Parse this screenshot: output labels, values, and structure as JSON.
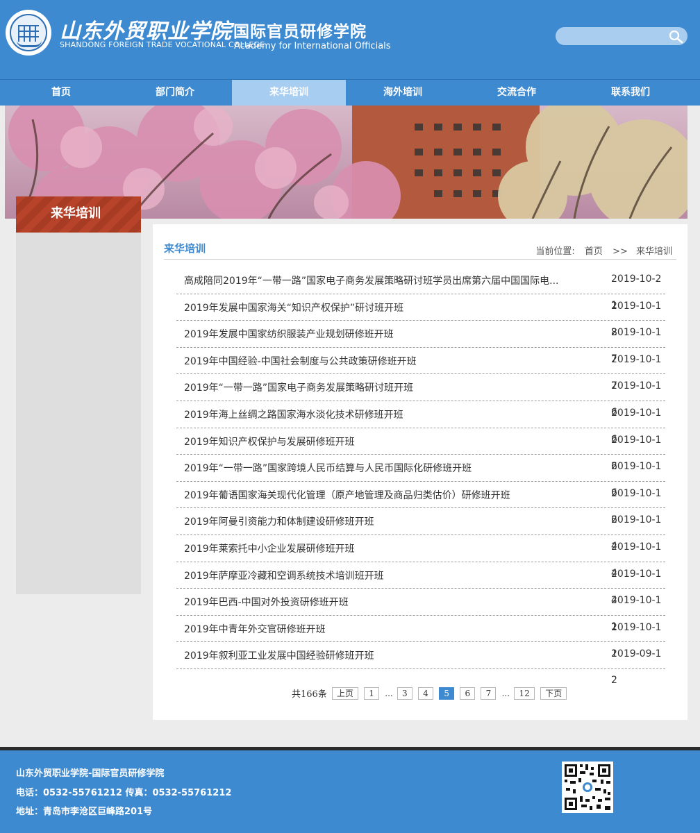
{
  "header": {
    "school_cn": "山东外贸职业学院",
    "school_en": "SHANDONG FOREIGN TRADE VOCATIONAL COLLEGE",
    "academy_cn": "国际官员研修学院",
    "academy_en": "Academy for International Officials",
    "search": {
      "value": "",
      "placeholder": ""
    }
  },
  "nav": {
    "items": [
      {
        "label": "首页"
      },
      {
        "label": "部门简介"
      },
      {
        "label": "来华培训"
      },
      {
        "label": "海外培训"
      },
      {
        "label": "交流合作"
      },
      {
        "label": "联系我们"
      }
    ],
    "active_index": 2
  },
  "sidebar": {
    "title": "来华培训"
  },
  "main": {
    "title": "来华培训",
    "breadcrumb": {
      "prefix": "当前位置:",
      "home": "首页",
      "sep": ">>",
      "current": "来华培训"
    },
    "news": [
      {
        "title": "高成陪同2019年“一带一路”国家电子商务发展策略研讨班学员出席第六届中国国际电...",
        "date": "2019-10-21"
      },
      {
        "title": "2019年发展中国家海关“知识产权保护”研讨班开班",
        "date": "2019-10-18"
      },
      {
        "title": "2019年发展中国家纺织服装产业规划研修班开班",
        "date": "2019-10-17"
      },
      {
        "title": "2019年中国经验-中国社会制度与公共政策研修班开班",
        "date": "2019-10-17"
      },
      {
        "title": "2019年“一带一路”国家电子商务发展策略研讨班开班",
        "date": "2019-10-16"
      },
      {
        "title": "2019年海上丝绸之路国家海水淡化技术研修班开班",
        "date": "2019-10-16"
      },
      {
        "title": "2019年知识产权保护与发展研修班开班",
        "date": "2019-10-16"
      },
      {
        "title": "2019年“一带一路”国家跨境人民币结算与人民币国际化研修班开班",
        "date": "2019-10-16"
      },
      {
        "title": "2019年葡语国家海关现代化管理（原产地管理及商品归类估价）研修班开班",
        "date": "2019-10-16"
      },
      {
        "title": "2019年阿曼引资能力和体制建设研修班开班",
        "date": "2019-10-14"
      },
      {
        "title": "2019年莱索托中小企业发展研修班开班",
        "date": "2019-10-14"
      },
      {
        "title": "2019年萨摩亚冷藏和空调系统技术培训班开班",
        "date": "2019-10-14"
      },
      {
        "title": "2019年巴西-中国对外投资研修班开班",
        "date": "2019-10-11"
      },
      {
        "title": "2019年中青年外交官研修班开班",
        "date": "2019-10-11"
      },
      {
        "title": "2019年叙利亚工业发展中国经验研修班开班",
        "date": "2019-09-12"
      }
    ],
    "pager": {
      "total": "共166条",
      "prev": "上页",
      "next": "下页",
      "pages": [
        "1",
        "3",
        "4",
        "5",
        "6",
        "7",
        "12"
      ],
      "current": "5",
      "ellipsis": "..."
    }
  },
  "footer": {
    "line1": "山东外贸职业学院-国际官员研修学院",
    "line2": "电话：0532-55761212 传真：0532-55761212",
    "line3": "地址：青岛市李沧区巨峰路201号"
  },
  "colors": {
    "primary": "#3e8ad0",
    "nav_active": "#a7cdf0",
    "sidebar_title": "#b7432a",
    "footer_bar": "#2a2a2a"
  }
}
